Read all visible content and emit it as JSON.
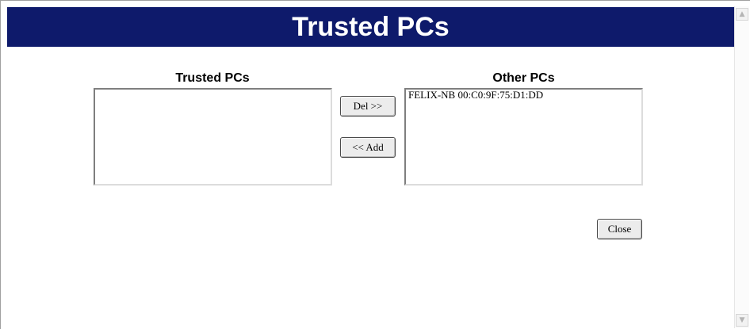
{
  "page": {
    "title": "Trusted PCs"
  },
  "trusted_list": {
    "label": "Trusted PCs",
    "items": []
  },
  "other_list": {
    "label": "Other PCs",
    "items": [
      "FELIX-NB 00:C0:9F:75:D1:DD"
    ]
  },
  "buttons": {
    "del": "Del >>",
    "add": "<< Add",
    "close": "Close"
  },
  "scrollbar": {
    "up_icon": "scroll-up-arrow",
    "down_icon": "scroll-down-arrow"
  }
}
